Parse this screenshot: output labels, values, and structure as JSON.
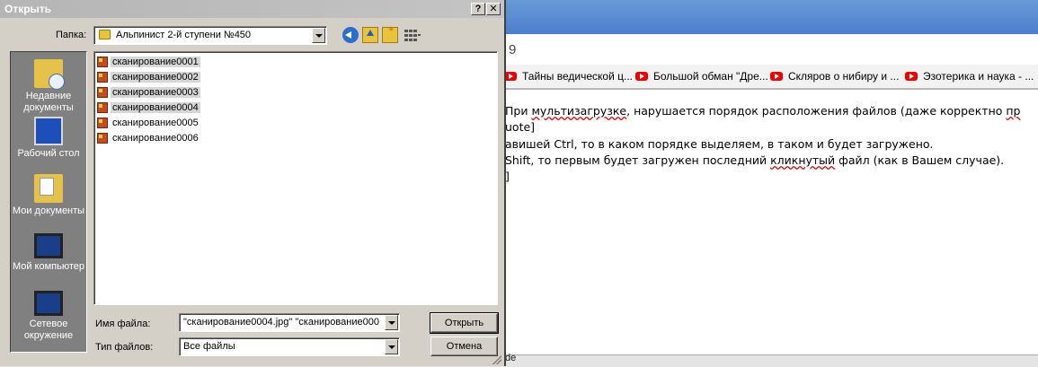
{
  "dialog": {
    "title": "Открыть",
    "help_label": "?",
    "close_label": "✕",
    "folder_label": "Папка:",
    "folder_value": "Альпинист 2-й ступени №450",
    "places": [
      {
        "label": "Недавние документы"
      },
      {
        "label": "Рабочий стол"
      },
      {
        "label": "Мои документы"
      },
      {
        "label": "Мой компьютер"
      },
      {
        "label": "Сетевое окружение"
      }
    ],
    "files": [
      {
        "name": "сканирование0001",
        "selected": true
      },
      {
        "name": "сканирование0002",
        "selected": true
      },
      {
        "name": "сканирование0003",
        "selected": true
      },
      {
        "name": "сканирование0004",
        "selected": true
      },
      {
        "name": "сканирование0005",
        "selected": false
      },
      {
        "name": "сканирование0006",
        "selected": false
      }
    ],
    "filename_label": "Имя файла:",
    "filename_value": "\"сканирование0004.jpg\" \"сканирование000",
    "filetype_label": "Тип файлов:",
    "filetype_value": "Все файлы",
    "open_button": "Открыть",
    "cancel_button": "Отмена"
  },
  "browser": {
    "address_fragment": "9",
    "bookmarks": [
      {
        "label": "Тайны ведической ц..."
      },
      {
        "label": "Большой обман \"Дре..."
      },
      {
        "label": "Скляров о нибиру и ..."
      },
      {
        "label": "Эзотерика и наука - ..."
      }
    ],
    "lines": {
      "l1_a": "При ",
      "l1_b": "мультизагрузке",
      "l1_c": ", нарушается порядок расположения файлов (даже корректно ",
      "l1_d": "пр",
      "l2": "uote]",
      "l3": "авишей Ctrl, то в каком порядке выделяем, в таком и будет загружено.",
      "l4_a": "Shift, то первым будет загружен последний ",
      "l4_b": "кликнутый",
      "l4_c": " файл (как в Вашем случае).",
      "l5": "]"
    },
    "bottom_fragment": "de"
  }
}
